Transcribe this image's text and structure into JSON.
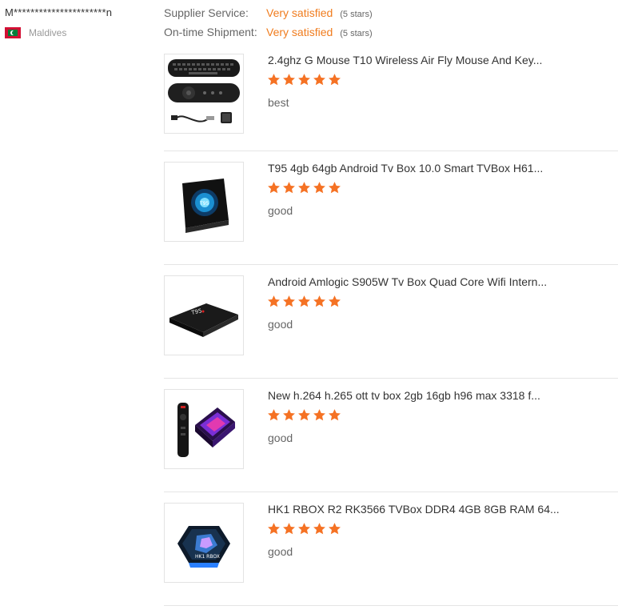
{
  "buyer": {
    "name": "M**********************n",
    "country": "Maldives",
    "flag_icon": "maldives-flag-icon"
  },
  "ratings": [
    {
      "label": "Supplier Service:",
      "value": "Very satisfied",
      "stars": "(5 stars)"
    },
    {
      "label": "On-time Shipment:",
      "value": "Very satisfied",
      "stars": "(5 stars)"
    }
  ],
  "colors": {
    "accent": "#f07c1e",
    "star": "#f57224",
    "divider": "#e5e5e5"
  },
  "products": [
    {
      "title": "2.4ghz G Mouse T10 Wireless Air Fly Mouse And Key...",
      "rating": 5,
      "comment": "best",
      "image_icon": "air-mouse-remote-image"
    },
    {
      "title": "T95 4gb 64gb Android Tv Box 10.0 Smart TVBox H61...",
      "rating": 5,
      "comment": "good",
      "image_icon": "tv-box-image"
    },
    {
      "title": "Android Amlogic S905W Tv Box Quad Core Wifi Intern...",
      "rating": 5,
      "comment": "good",
      "image_icon": "tv-box-image"
    },
    {
      "title": "New h.264 h.265 ott tv box 2gb 16gb h96 max 3318 f...",
      "rating": 5,
      "comment": "good",
      "image_icon": "tv-box-with-remote-image"
    },
    {
      "title": "HK1 RBOX R2 RK3566 TVBox DDR4 4GB 8GB RAM 64...",
      "rating": 5,
      "comment": "good",
      "image_icon": "tv-box-image"
    }
  ]
}
